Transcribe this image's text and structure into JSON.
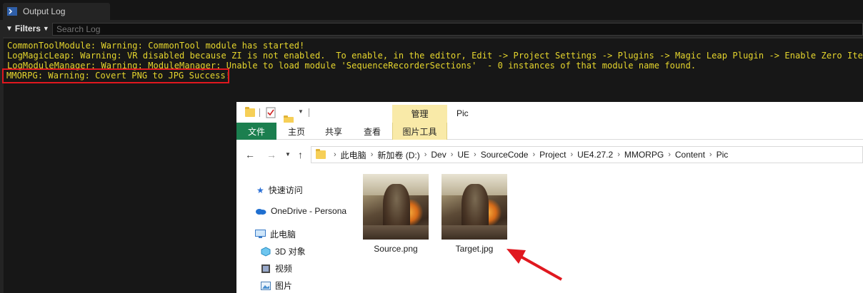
{
  "output_log": {
    "tab_title": "Output Log",
    "filters_label": "Filters",
    "search_placeholder": "Search Log",
    "lines": [
      "CommonToolModule: Warning: CommonTool module has started!",
      "LogMagicLeap: Warning: VR disabled because ZI is not enabled.  To enable, in the editor, Edit -> Project Settings -> Plugins -> Magic Leap Plugin -> Enable Zero Iteration",
      "LogModuleManager: Warning: ModuleManager: Unable to load module 'SequenceRecorderSections'  - 0 instances of that module name found.",
      "MMORPG: Warning: Covert PNG to JPG Success!"
    ],
    "text_color": "#e6d62d",
    "highlight_color": "#e0181f"
  },
  "explorer": {
    "manage_tab": "管理",
    "window_title": "Pic",
    "ribbon_tabs": [
      "文件",
      "主页",
      "共享",
      "查看",
      "图片工具"
    ],
    "breadcrumb": [
      "此电脑",
      "新加卷 (D:)",
      "Dev",
      "UE",
      "SourceCode",
      "Project",
      "UE4.27.2",
      "MMORPG",
      "Content",
      "Pic"
    ],
    "nav_items": [
      "快速访问",
      "OneDrive - Persona",
      "此电脑",
      "3D 对象",
      "视频",
      "图片"
    ],
    "files": [
      "Source.png",
      "Target.jpg"
    ],
    "accent_color": "#1b7f4f",
    "contextual_tab_color": "#f9eaa8"
  }
}
